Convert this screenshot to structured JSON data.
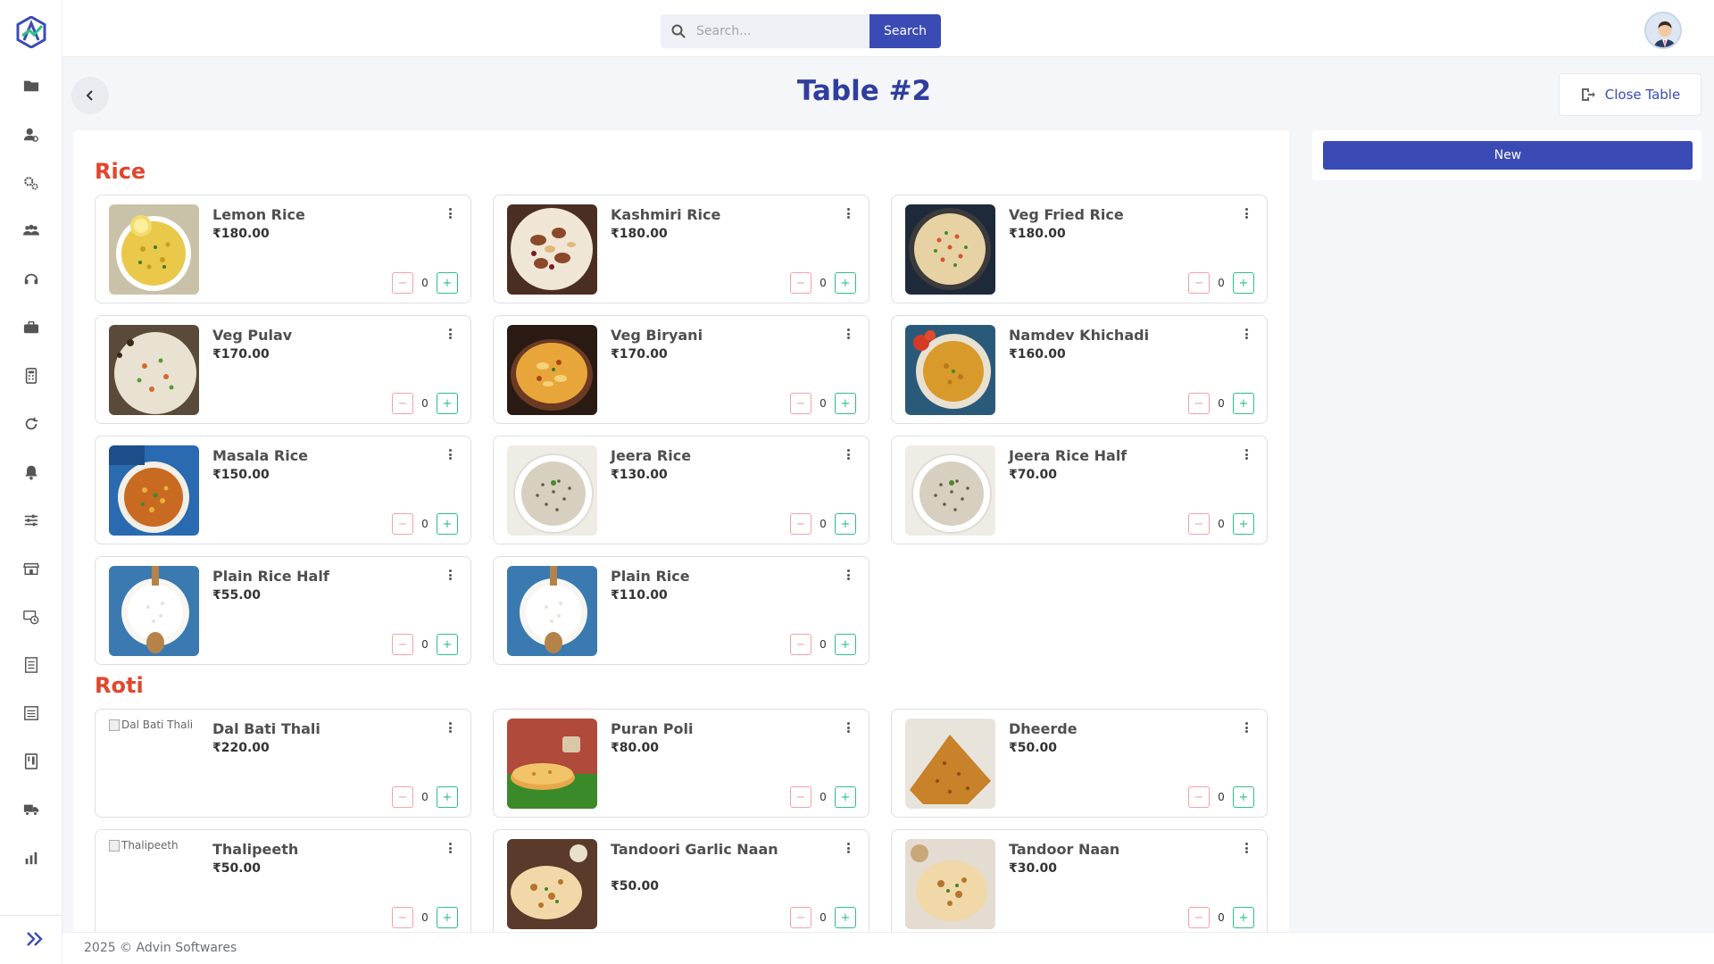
{
  "header": {
    "search_placeholder": "Search...",
    "search_button": "Search"
  },
  "page": {
    "title": "Table #2",
    "close_table_label": "Close Table",
    "new_button_label": "New"
  },
  "sidebar": {
    "icons": [
      "folder-icon",
      "user-settings-icon",
      "gears-icon",
      "users-icon",
      "headset-icon",
      "briefcase-icon",
      "calculator-icon",
      "refresh-icon",
      "bell-icon",
      "sliders-icon",
      "store-icon",
      "money-clock-icon",
      "receipt-icon",
      "list-icon",
      "menu-book-icon",
      "truck-icon",
      "bar-chart-icon"
    ]
  },
  "categories": [
    {
      "name": "Rice",
      "items": [
        {
          "name": "Lemon Rice",
          "price": "₹180.00",
          "qty": "0",
          "image": "lemon-rice"
        },
        {
          "name": "Kashmiri Rice",
          "price": "₹180.00",
          "qty": "0",
          "image": "kashmiri-rice"
        },
        {
          "name": "Veg Fried Rice",
          "price": "₹180.00",
          "qty": "0",
          "image": "veg-fried-rice"
        },
        {
          "name": "Veg Pulav",
          "price": "₹170.00",
          "qty": "0",
          "image": "veg-pulav"
        },
        {
          "name": "Veg Biryani",
          "price": "₹170.00",
          "qty": "0",
          "image": "veg-biryani"
        },
        {
          "name": "Namdev Khichadi",
          "price": "₹160.00",
          "qty": "0",
          "image": "namdev-khichadi"
        },
        {
          "name": "Masala Rice",
          "price": "₹150.00",
          "qty": "0",
          "image": "masala-rice"
        },
        {
          "name": "Jeera Rice",
          "price": "₹130.00",
          "qty": "0",
          "image": "jeera-rice"
        },
        {
          "name": "Jeera Rice Half",
          "price": "₹70.00",
          "qty": "0",
          "image": "jeera-rice"
        },
        {
          "name": "Plain Rice Half",
          "price": "₹55.00",
          "qty": "0",
          "image": "plain-rice"
        },
        {
          "name": "Plain Rice",
          "price": "₹110.00",
          "qty": "0",
          "image": "plain-rice"
        }
      ]
    },
    {
      "name": "Roti",
      "items": [
        {
          "name": "Dal Bati Thali",
          "price": "₹220.00",
          "qty": "0",
          "image": "broken",
          "alt": "Dal Bati Thali"
        },
        {
          "name": "Puran Poli",
          "price": "₹80.00",
          "qty": "0",
          "image": "puran-poli"
        },
        {
          "name": "Dheerde",
          "price": "₹50.00",
          "qty": "0",
          "image": "dheerde"
        },
        {
          "name": "Thalipeeth",
          "price": "₹50.00",
          "qty": "0",
          "image": "broken",
          "alt": "Thalipeeth"
        },
        {
          "name": "Tandoori Garlic Naan",
          "price": "₹50.00",
          "qty": "0",
          "image": "garlic-naan"
        },
        {
          "name": "Tandoor Naan",
          "price": "₹30.00",
          "qty": "0",
          "image": "tandoor-naan"
        }
      ]
    }
  ],
  "footer": {
    "text": "2025 © Advin Softwares"
  }
}
